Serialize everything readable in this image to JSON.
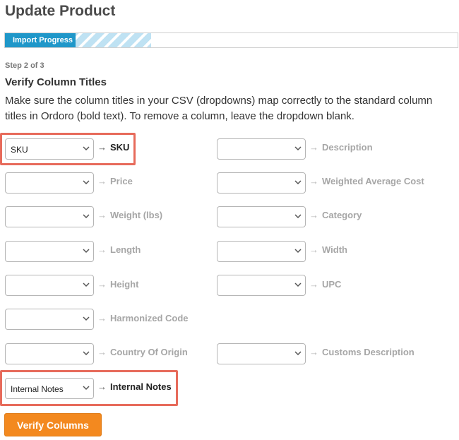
{
  "page": {
    "title": "Update Product"
  },
  "progress": {
    "label": "Import Progress"
  },
  "step": {
    "label": "Step 2 of 3"
  },
  "section": {
    "title": "Verify Column Titles",
    "instructions": "Make sure the column titles in your CSV (dropdowns) map correctly to the standard column titles in Ordoro (bold text). To remove a column, leave the dropdown blank."
  },
  "arrow": "→",
  "mappings": {
    "sku": {
      "selected": "SKU",
      "target": "SKU"
    },
    "description": {
      "selected": "",
      "target": "Description"
    },
    "price": {
      "selected": "",
      "target": "Price"
    },
    "weighted_average_cost": {
      "selected": "",
      "target": "Weighted Average Cost"
    },
    "weight": {
      "selected": "",
      "target": "Weight (lbs)"
    },
    "category": {
      "selected": "",
      "target": "Category"
    },
    "length": {
      "selected": "",
      "target": "Length"
    },
    "width": {
      "selected": "",
      "target": "Width"
    },
    "height": {
      "selected": "",
      "target": "Height"
    },
    "upc": {
      "selected": "",
      "target": "UPC"
    },
    "harmonized_code": {
      "selected": "",
      "target": "Harmonized Code"
    },
    "country_of_origin": {
      "selected": "",
      "target": "Country Of Origin"
    },
    "customs_description": {
      "selected": "",
      "target": "Customs Description"
    },
    "internal_notes": {
      "selected": "Internal Notes",
      "target": "Internal Notes"
    }
  },
  "actions": {
    "verify_label": "Verify Columns"
  },
  "colors": {
    "accent": "#f3891f",
    "progress": "#1f97c9",
    "highlight": "#e76b5b"
  },
  "icons": {
    "dropdown": "chevron-down-icon",
    "arrow": "arrow-right-icon"
  }
}
